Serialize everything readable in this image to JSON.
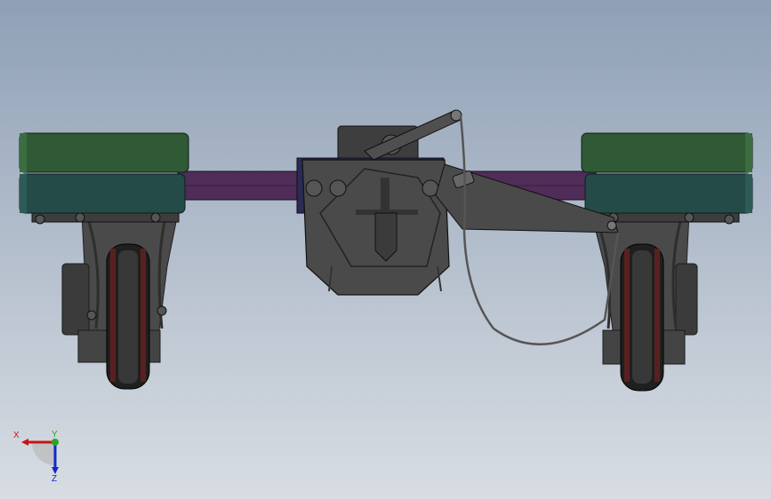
{
  "viewport": {
    "background_top": "#8fa0b6",
    "background_bottom": "#d8dde3"
  },
  "model": {
    "parts": {
      "upper_pad_color": "#2f5a35",
      "lower_pad_color": "#244b48",
      "crossbar_color": "#4f2d58",
      "metal_color": "#4a4a4a",
      "dark_metal_color": "#2e2e2e",
      "tire_color": "#1f1f1f",
      "hub_color": "#5a2020",
      "cable_color": "#555555"
    }
  },
  "triad": {
    "x_label": "X",
    "y_label": "Y",
    "z_label": "Z",
    "x_color": "#c81414",
    "y_color": "#2aa52a",
    "z_color": "#1428c8"
  }
}
